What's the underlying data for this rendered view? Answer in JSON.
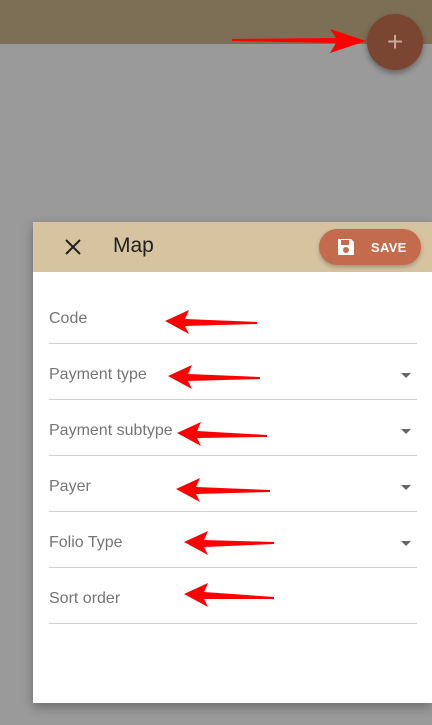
{
  "fab": {
    "label": "+"
  },
  "dialog": {
    "title": "Map",
    "save_label": "SAVE",
    "fields": [
      {
        "label": "Code",
        "dropdown": false
      },
      {
        "label": "Payment type",
        "dropdown": true
      },
      {
        "label": "Payment subtype",
        "dropdown": true
      },
      {
        "label": "Payer",
        "dropdown": true
      },
      {
        "label": "Folio Type",
        "dropdown": true
      },
      {
        "label": "Sort order",
        "dropdown": false
      }
    ]
  },
  "colors": {
    "topbar": "#7d6e56",
    "fab": "#7a4632",
    "dialog_header": "#d6c3a0",
    "save_button": "#c46a4d",
    "annotation_arrow": "#ff0000"
  }
}
